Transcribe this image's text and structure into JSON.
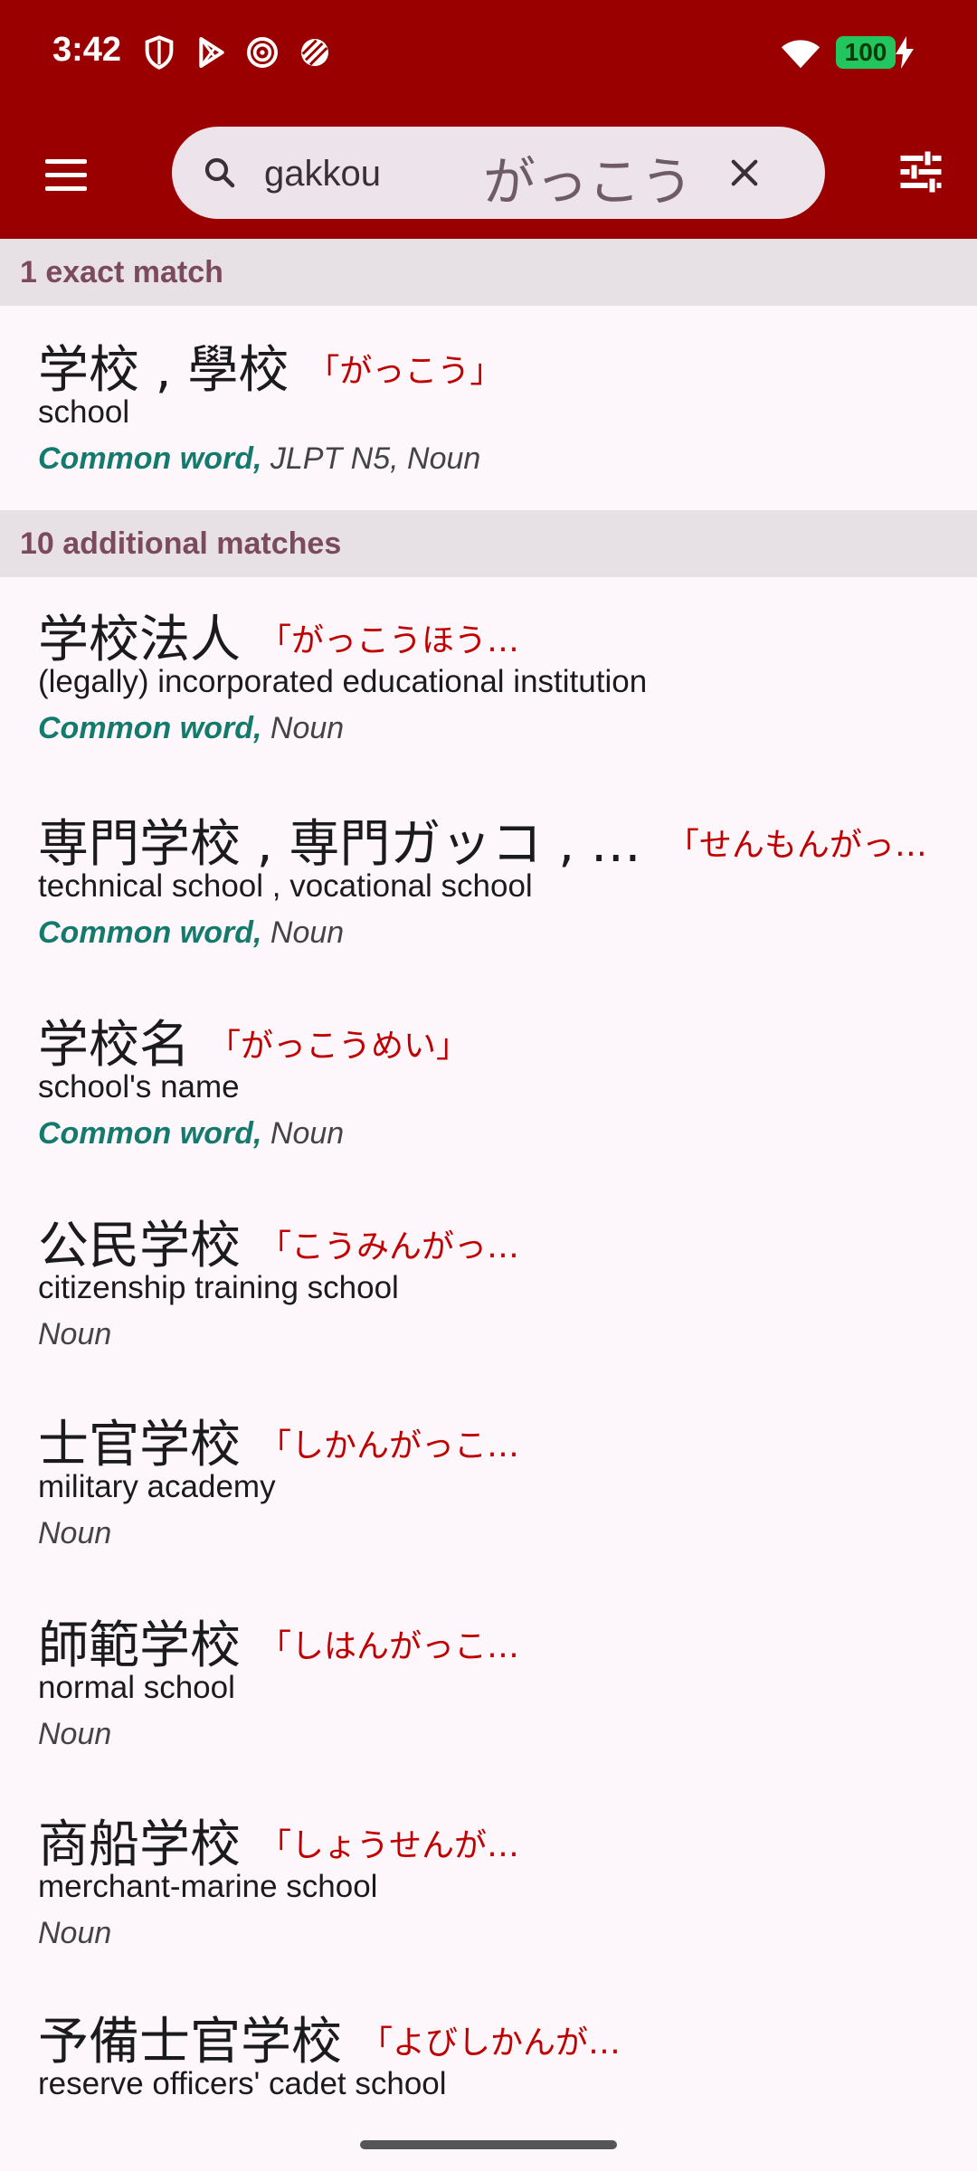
{
  "status_bar": {
    "time": "3:42",
    "battery": "100"
  },
  "search": {
    "query": "gakkou",
    "kana": "がっこう"
  },
  "sections": {
    "exact": "1 exact match",
    "additional": "10 additional matches"
  },
  "entries": [
    {
      "word": "学校 , 學校",
      "reading": "「がっこう」",
      "meaning": "school",
      "common": "Common word,",
      "tags": " JLPT N5, Noun"
    },
    {
      "word": "学校法人",
      "reading": "「がっこうほう…",
      "meaning": "(legally) incorporated educational institution",
      "common": "Common word,",
      "tags": " Noun"
    },
    {
      "word": "専門学校 , 専門ガッコ , …",
      "reading": "「せんもんがっ…",
      "meaning": "technical school , vocational school",
      "common": "Common word,",
      "tags": " Noun"
    },
    {
      "word": "学校名",
      "reading": "「がっこうめい」",
      "meaning": "school's name",
      "common": "Common word,",
      "tags": " Noun"
    },
    {
      "word": "公民学校",
      "reading": "「こうみんがっ…",
      "meaning": "citizenship training school",
      "common": "",
      "tags": "Noun"
    },
    {
      "word": "士官学校",
      "reading": "「しかんがっこ…",
      "meaning": "military academy",
      "common": "",
      "tags": "Noun"
    },
    {
      "word": "師範学校",
      "reading": "「しはんがっこ…",
      "meaning": "normal school",
      "common": "",
      "tags": "Noun"
    },
    {
      "word": "商船学校",
      "reading": "「しょうせんが…",
      "meaning": "merchant-marine school",
      "common": "",
      "tags": "Noun"
    },
    {
      "word": "予備士官学校",
      "reading": "「よびしかんが…",
      "meaning": "reserve officers' cadet school",
      "common": "",
      "tags": ""
    }
  ],
  "icons": {
    "menu": "hamburger-menu-icon",
    "search": "search-icon",
    "clear": "close-icon",
    "filter": "tune-icon"
  },
  "colors": {
    "appbar": "#9a0000",
    "reading": "#c00000",
    "common": "#157a6e",
    "section_text": "#7b4a5d"
  }
}
